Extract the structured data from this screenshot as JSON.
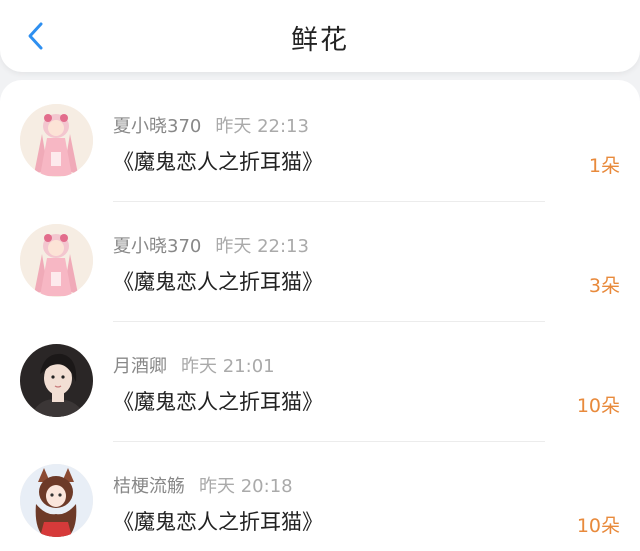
{
  "header": {
    "back_icon": "chevron-left-icon",
    "title": "鲜花"
  },
  "colors": {
    "accent": "#2e8ff0",
    "flower_count": "#e88a3c"
  },
  "records": [
    {
      "user": "夏小晓370",
      "time": "昨天 22:13",
      "book": "《魔鬼恋人之折耳猫》",
      "count": "1朵",
      "avatar": "anime-girl-pink-avatar"
    },
    {
      "user": "夏小晓370",
      "time": "昨天 22:13",
      "book": "《魔鬼恋人之折耳猫》",
      "count": "3朵",
      "avatar": "anime-girl-pink-avatar"
    },
    {
      "user": "月酒卿",
      "time": "昨天 21:01",
      "book": "《魔鬼恋人之折耳猫》",
      "count": "10朵",
      "avatar": "photo-woman-avatar"
    },
    {
      "user": "桔梗流觞",
      "time": "昨天 20:18",
      "book": "《魔鬼恋人之折耳猫》",
      "count": "10朵",
      "avatar": "fox-ear-girl-avatar"
    }
  ]
}
